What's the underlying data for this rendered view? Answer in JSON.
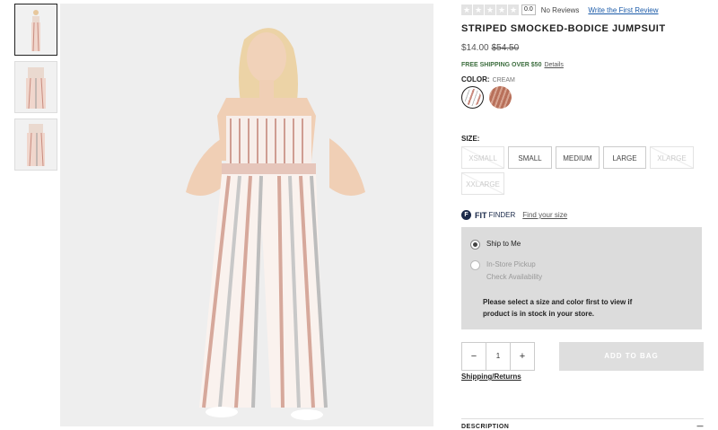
{
  "rating": {
    "score": "0.0",
    "no_reviews": "No Reviews",
    "write_first": "Write the First Review"
  },
  "product": {
    "title": "STRIPED SMOCKED-BODICE JUMPSUIT",
    "price": "$14.00",
    "old_price": "$54.50"
  },
  "shipping": {
    "text": "FREE SHIPPING OVER $50",
    "details": "Details"
  },
  "color": {
    "label": "COLOR:",
    "value": "CREAM",
    "swatches": [
      "cream",
      "rust"
    ]
  },
  "size": {
    "label": "SIZE:",
    "options": [
      "XSMALL",
      "SMALL",
      "MEDIUM",
      "LARGE",
      "XLARGE",
      "XXLARGE"
    ],
    "available": [
      false,
      true,
      true,
      true,
      false,
      false
    ]
  },
  "fit": {
    "brand": "FIT",
    "finder": "FINDER",
    "link": "Find your size",
    "icon": "fit-finder-icon"
  },
  "pickup": {
    "ship": "Ship to Me",
    "store": "In-Store Pickup",
    "check": "Check Availability",
    "note": "Please select a size and color first to view if product is in stock in your store."
  },
  "cart": {
    "qty": "1",
    "minus": "−",
    "plus": "+",
    "add": "ADD TO BAG",
    "shipping_returns": "Shipping/Returns"
  },
  "description": {
    "label": "DESCRIPTION",
    "icon": "minus-icon"
  },
  "colors": {
    "accent_green": "#3d6e3f",
    "link_blue": "#1a5aa8",
    "fit_navy": "#1b2a4a"
  }
}
